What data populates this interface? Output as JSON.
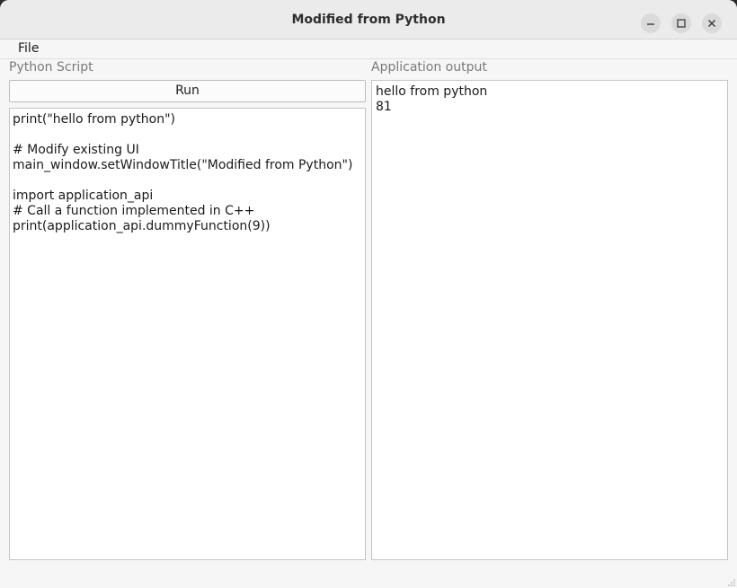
{
  "window": {
    "title": "Modified from Python",
    "buttons": [
      "minimize",
      "maximize",
      "close"
    ]
  },
  "menubar": {
    "items": [
      {
        "label": "File"
      }
    ]
  },
  "script_panel": {
    "label": "Python Script",
    "run_label": "Run",
    "code_lines": [
      "print(\"hello from python\")",
      "",
      "# Modify existing UI",
      "main_window.setWindowTitle(\"Modified from Python\")",
      "",
      "import application_api",
      "# Call a function implemented in C++",
      "print(application_api.dummyFunction(9))"
    ]
  },
  "output_panel": {
    "label": "Application output",
    "lines": [
      "hello from python",
      "81"
    ]
  },
  "icons": {
    "minimize": "minimize-icon",
    "maximize": "maximize-icon",
    "close": "close-icon",
    "grip": "resize-grip-icon"
  }
}
